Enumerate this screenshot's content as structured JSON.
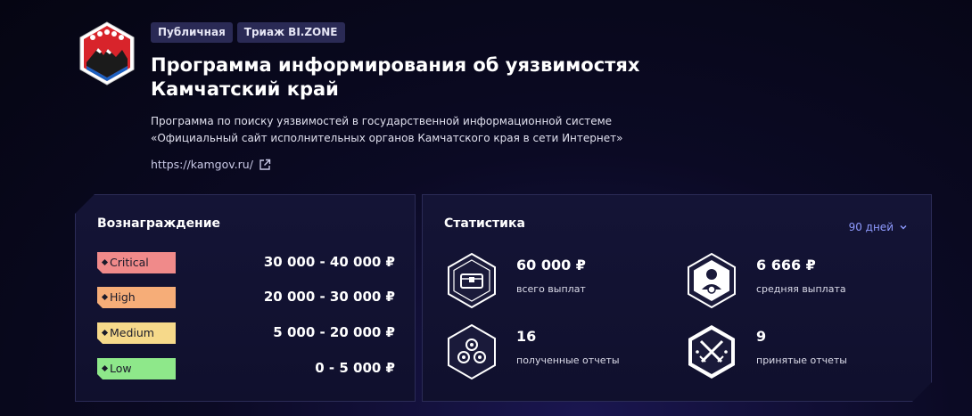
{
  "tags": [
    "Публичная",
    "Триаж BI.ZONE"
  ],
  "title_line1": "Программа информирования об уязвимостях",
  "title_line2": "Камчатский край",
  "description_line1": "Программа по поиску уязвимостей в государственной информационной системе",
  "description_line2": "«Официальный сайт исполнительных органов Камчатского края в сети Интернет»",
  "link": "https://kamgov.ru/",
  "rewards": {
    "title": "Вознаграждение",
    "rows": [
      {
        "severity": "Critical",
        "color": "#f08a8a",
        "amount": "30 000 - 40 000 ₽"
      },
      {
        "severity": "High",
        "color": "#f6ad78",
        "amount": "20 000 - 30 000 ₽"
      },
      {
        "severity": "Medium",
        "color": "#f6d98a",
        "amount": "5 000 - 20 000 ₽"
      },
      {
        "severity": "Low",
        "color": "#8ee88a",
        "amount": "0 - 5 000 ₽"
      }
    ]
  },
  "stats": {
    "title": "Статистика",
    "period": "90 дней",
    "items": [
      {
        "value": "60 000 ₽",
        "label": "всего выплат",
        "icon": "treasure-chest-icon"
      },
      {
        "value": "6 666 ₽",
        "label": "средняя выплата",
        "icon": "user-badge-icon"
      },
      {
        "value": "16",
        "label": "полученные отчеты",
        "icon": "reports-received-icon"
      },
      {
        "value": "9",
        "label": "принятые отчеты",
        "icon": "crossed-swords-icon"
      }
    ]
  }
}
